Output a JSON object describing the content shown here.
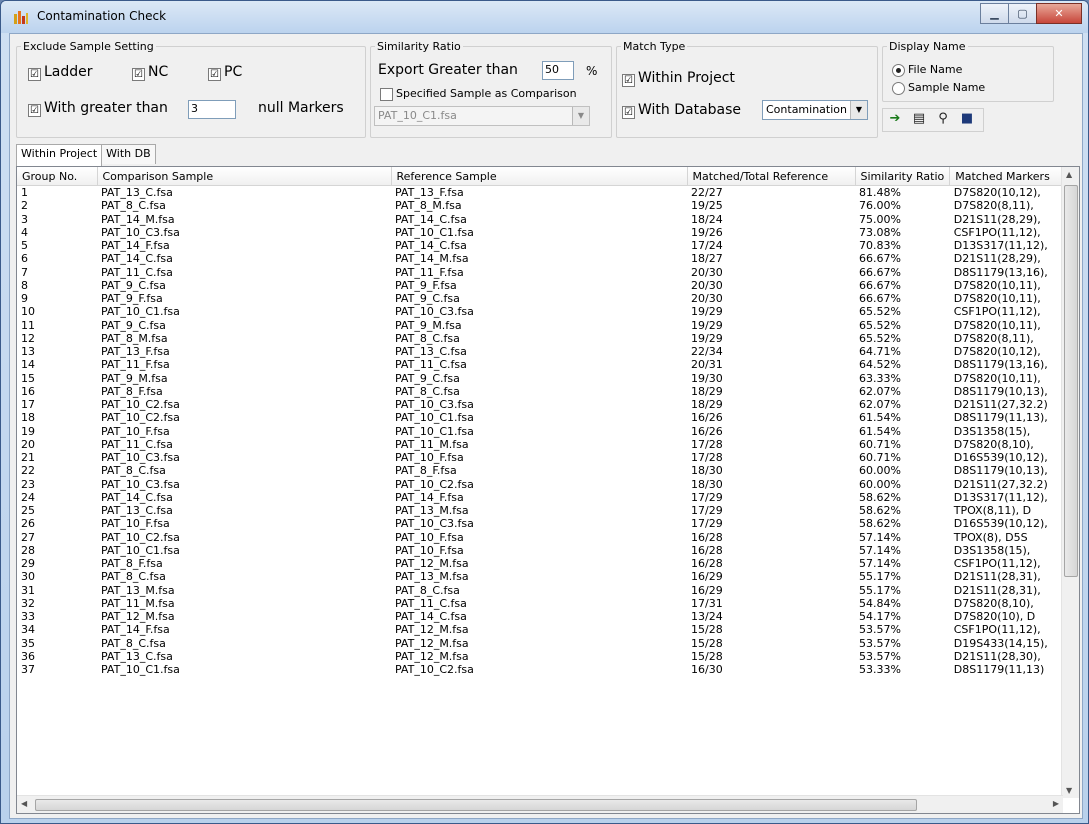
{
  "window": {
    "title": "Contamination Check"
  },
  "exclude": {
    "legend": "Exclude Sample Setting",
    "ladder": "Ladder",
    "nc": "NC",
    "pc": "PC",
    "greater_label": "With greater than",
    "greater_value": "3",
    "null_label": "null Markers",
    "check": "☑"
  },
  "similarity": {
    "legend": "Similarity Ratio",
    "export_label": "Export Greater than",
    "export_value": "50",
    "unit": "%",
    "specified_label": "Specified Sample as Comparison",
    "sample_value": "PAT_10_C1.fsa"
  },
  "match": {
    "legend": "Match Type",
    "within": "Within Project",
    "with_db": "With Database",
    "db_value": "Contamination"
  },
  "display": {
    "legend": "Display Name",
    "file_name": "File Name",
    "sample_name": "Sample Name"
  },
  "tabs": [
    "Within Project",
    "With DB"
  ],
  "table": {
    "columns": [
      "Group No.",
      "Comparison Sample",
      "Reference Sample",
      "Matched/Total Reference",
      "Similarity Ratio",
      "Matched Markers"
    ],
    "rows": [
      [
        "1",
        "PAT_13_C.fsa",
        "PAT_13_F.fsa",
        "22/27",
        "81.48%",
        "D7S820(10,12),"
      ],
      [
        "2",
        "PAT_8_C.fsa",
        "PAT_8_M.fsa",
        "19/25",
        "76.00%",
        "D7S820(8,11),"
      ],
      [
        "3",
        "PAT_14_M.fsa",
        "PAT_14_C.fsa",
        "18/24",
        "75.00%",
        "D21S11(28,29),"
      ],
      [
        "4",
        "PAT_10_C3.fsa",
        "PAT_10_C1.fsa",
        "19/26",
        "73.08%",
        "CSF1PO(11,12),"
      ],
      [
        "5",
        "PAT_14_F.fsa",
        "PAT_14_C.fsa",
        "17/24",
        "70.83%",
        "D13S317(11,12),"
      ],
      [
        "6",
        "PAT_14_C.fsa",
        "PAT_14_M.fsa",
        "18/27",
        "66.67%",
        "D21S11(28,29),"
      ],
      [
        "7",
        "PAT_11_C.fsa",
        "PAT_11_F.fsa",
        "20/30",
        "66.67%",
        "D8S1179(13,16),"
      ],
      [
        "8",
        "PAT_9_C.fsa",
        "PAT_9_F.fsa",
        "20/30",
        "66.67%",
        "D7S820(10,11),"
      ],
      [
        "9",
        "PAT_9_F.fsa",
        "PAT_9_C.fsa",
        "20/30",
        "66.67%",
        "D7S820(10,11),"
      ],
      [
        "10",
        "PAT_10_C1.fsa",
        "PAT_10_C3.fsa",
        "19/29",
        "65.52%",
        "CSF1PO(11,12),"
      ],
      [
        "11",
        "PAT_9_C.fsa",
        "PAT_9_M.fsa",
        "19/29",
        "65.52%",
        "D7S820(10,11),"
      ],
      [
        "12",
        "PAT_8_M.fsa",
        "PAT_8_C.fsa",
        "19/29",
        "65.52%",
        "D7S820(8,11),"
      ],
      [
        "13",
        "PAT_13_F.fsa",
        "PAT_13_C.fsa",
        "22/34",
        "64.71%",
        "D7S820(10,12),"
      ],
      [
        "14",
        "PAT_11_F.fsa",
        "PAT_11_C.fsa",
        "20/31",
        "64.52%",
        "D8S1179(13,16),"
      ],
      [
        "15",
        "PAT_9_M.fsa",
        "PAT_9_C.fsa",
        "19/30",
        "63.33%",
        "D7S820(10,11),"
      ],
      [
        "16",
        "PAT_8_F.fsa",
        "PAT_8_C.fsa",
        "18/29",
        "62.07%",
        "D8S1179(10,13),"
      ],
      [
        "17",
        "PAT_10_C2.fsa",
        "PAT_10_C3.fsa",
        "18/29",
        "62.07%",
        "D21S11(27,32.2)"
      ],
      [
        "18",
        "PAT_10_C2.fsa",
        "PAT_10_C1.fsa",
        "16/26",
        "61.54%",
        "D8S1179(11,13),"
      ],
      [
        "19",
        "PAT_10_F.fsa",
        "PAT_10_C1.fsa",
        "16/26",
        "61.54%",
        "D3S1358(15),"
      ],
      [
        "20",
        "PAT_11_C.fsa",
        "PAT_11_M.fsa",
        "17/28",
        "60.71%",
        "D7S820(8,10),"
      ],
      [
        "21",
        "PAT_10_C3.fsa",
        "PAT_10_F.fsa",
        "17/28",
        "60.71%",
        "D16S539(10,12),"
      ],
      [
        "22",
        "PAT_8_C.fsa",
        "PAT_8_F.fsa",
        "18/30",
        "60.00%",
        "D8S1179(10,13),"
      ],
      [
        "23",
        "PAT_10_C3.fsa",
        "PAT_10_C2.fsa",
        "18/30",
        "60.00%",
        "D21S11(27,32.2)"
      ],
      [
        "24",
        "PAT_14_C.fsa",
        "PAT_14_F.fsa",
        "17/29",
        "58.62%",
        "D13S317(11,12),"
      ],
      [
        "25",
        "PAT_13_C.fsa",
        "PAT_13_M.fsa",
        "17/29",
        "58.62%",
        "TPOX(8,11), D"
      ],
      [
        "26",
        "PAT_10_F.fsa",
        "PAT_10_C3.fsa",
        "17/29",
        "58.62%",
        "D16S539(10,12),"
      ],
      [
        "27",
        "PAT_10_C2.fsa",
        "PAT_10_F.fsa",
        "16/28",
        "57.14%",
        "TPOX(8), D5S"
      ],
      [
        "28",
        "PAT_10_C1.fsa",
        "PAT_10_F.fsa",
        "16/28",
        "57.14%",
        "D3S1358(15),"
      ],
      [
        "29",
        "PAT_8_F.fsa",
        "PAT_12_M.fsa",
        "16/28",
        "57.14%",
        "CSF1PO(11,12),"
      ],
      [
        "30",
        "PAT_8_C.fsa",
        "PAT_13_M.fsa",
        "16/29",
        "55.17%",
        "D21S11(28,31),"
      ],
      [
        "31",
        "PAT_13_M.fsa",
        "PAT_8_C.fsa",
        "16/29",
        "55.17%",
        "D21S11(28,31),"
      ],
      [
        "32",
        "PAT_11_M.fsa",
        "PAT_11_C.fsa",
        "17/31",
        "54.84%",
        "D7S820(8,10),"
      ],
      [
        "33",
        "PAT_12_M.fsa",
        "PAT_14_C.fsa",
        "13/24",
        "54.17%",
        "D7S820(10), D"
      ],
      [
        "34",
        "PAT_14_F.fsa",
        "PAT_12_M.fsa",
        "15/28",
        "53.57%",
        "CSF1PO(11,12),"
      ],
      [
        "35",
        "PAT_8_C.fsa",
        "PAT_12_M.fsa",
        "15/28",
        "53.57%",
        "D19S433(14,15),"
      ],
      [
        "36",
        "PAT_13_C.fsa",
        "PAT_12_M.fsa",
        "15/28",
        "53.57%",
        "D21S11(28,30),"
      ],
      [
        "37",
        "PAT_10_C1.fsa",
        "PAT_10_C2.fsa",
        "16/30",
        "53.33%",
        "D8S1179(11,13)"
      ]
    ]
  },
  "icons": [
    "add-icon",
    "export-icon",
    "find-icon",
    "save-icon"
  ],
  "colors": {
    "titlebar": "#bcd3ee",
    "close_button": "#c7463a"
  }
}
